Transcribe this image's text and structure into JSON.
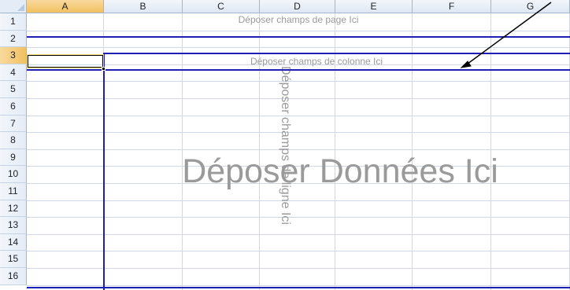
{
  "spreadsheet": {
    "columns": [
      {
        "label": "A",
        "selected": true
      },
      {
        "label": "B",
        "selected": false
      },
      {
        "label": "C",
        "selected": false
      },
      {
        "label": "D",
        "selected": false
      },
      {
        "label": "E",
        "selected": false
      },
      {
        "label": "F",
        "selected": false
      },
      {
        "label": "G",
        "selected": false
      }
    ],
    "rows": [
      {
        "label": "1",
        "selected": false
      },
      {
        "label": "2",
        "selected": false
      },
      {
        "label": "3",
        "selected": true
      },
      {
        "label": "4",
        "selected": false
      },
      {
        "label": "5",
        "selected": false
      },
      {
        "label": "6",
        "selected": false
      },
      {
        "label": "7",
        "selected": false
      },
      {
        "label": "8",
        "selected": false
      },
      {
        "label": "9",
        "selected": false
      },
      {
        "label": "10",
        "selected": false
      },
      {
        "label": "11",
        "selected": false
      },
      {
        "label": "12",
        "selected": false
      },
      {
        "label": "13",
        "selected": false
      },
      {
        "label": "14",
        "selected": false
      },
      {
        "label": "15",
        "selected": false
      },
      {
        "label": "16",
        "selected": false
      }
    ],
    "active_cell": "A3"
  },
  "pivot_table": {
    "page_fields_text": "Déposer champs de page Ici",
    "column_fields_text": "Déposer champs de colonne Ici",
    "row_fields_text": "Déposer champs de ligne Ici",
    "data_items_text": "Déposer Données Ici"
  },
  "colors": {
    "pivot_border": "#1f1fb3",
    "placeholder_text": "#9a9a9a",
    "header_selected": "#f1c15f",
    "gridline": "#d0d7e5"
  }
}
